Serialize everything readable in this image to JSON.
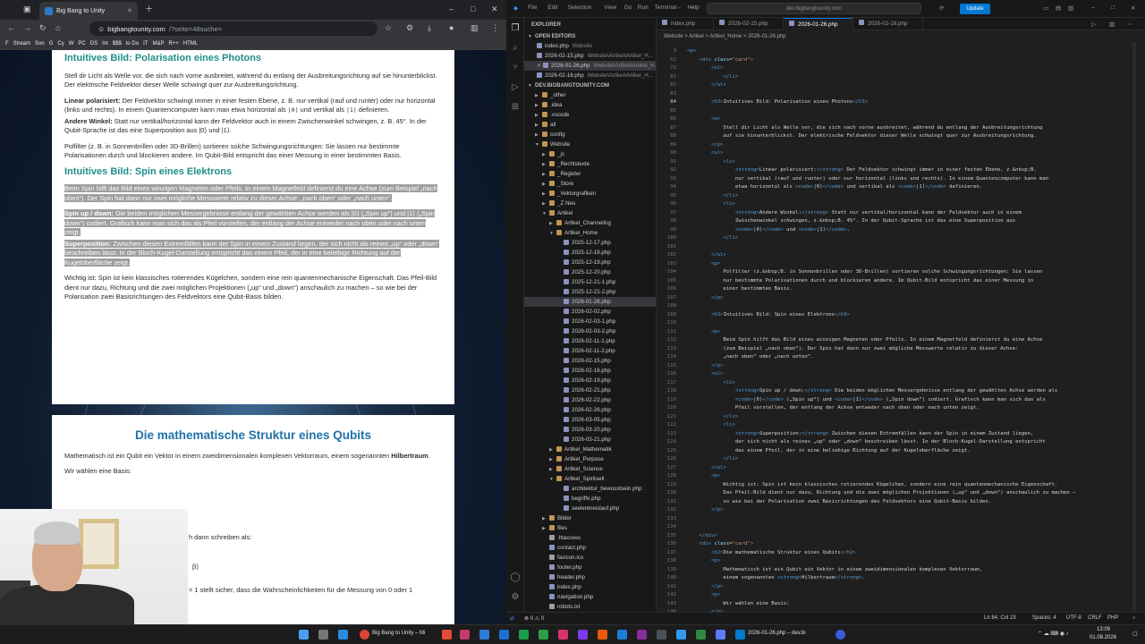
{
  "browser": {
    "tab_title": "Big Bang to Unity",
    "url_domain": "bigbangtounity.com",
    "url_path": "/?seite=48suche=",
    "bookmarks": [
      "F",
      "Stream",
      "Son",
      "G",
      "Cy",
      "W",
      "PC",
      "DS",
      "Int",
      "$$$",
      "to Do",
      "IT",
      "M&P",
      "R++",
      "HTML"
    ],
    "page": {
      "h3_polarisation": "Intuitives Bild: Polarisation eines Photons",
      "p_polar_intro": "Stell dir Licht als Welle vor, die sich nach vorne ausbreitet, während du entlang der Ausbreitungsrichtung auf sie hinunterblickst. Der elektrische Feldvektor dieser Welle schwingt quer zur Ausbreitungsrichtung.",
      "li_linear_strong": "Linear polarisiert:",
      "li_linear_text": "Der Feldvektor schwingt immer in einer festen Ebene, z. B. nur vertikal (rauf und runter) oder nur horizontal (links und rechts). In einem Quantencomputer kann man etwa horizontal als",
      "li_linear_ket0": "|0⟩",
      "li_linear_mid": "und vertikal als",
      "li_linear_ket1": "|1⟩",
      "li_linear_end": "definieren.",
      "li_angle_strong": "Andere Winkel:",
      "li_angle_text": "Statt nur vertikal/horizontal kann der Feldvektor auch in einem Zwischenwinkel schwingen, z. B. 45°. In der Qubit-Sprache ist das eine Superposition aus |0⟩ und |1⟩.",
      "p_polfilter": "Polfilter (z. B. in Sonnenbrillen oder 3D-Brillen) sortieren solche Schwingungsrichtungen: Sie lassen nur bestimmte Polarisationen durch und blockieren andere. Im Qubit-Bild entspricht das einer Messung in einer bestimmten Basis.",
      "h3_spin": "Intuitives Bild: Spin eines Elektrons",
      "p_spin_sel": "Beim Spin hilft das Bild eines winzigen Magneten oder Pfeils. In einem Magnetfeld definierst du eine Achse (zum Beispiel „nach oben“). Der Spin hat dann nur zwei mögliche Messwerte relativ zu dieser Achse: „nach oben“ oder „nach unten“.",
      "li_updown_strong": "Spin up / down:",
      "li_updown_text": "Die beiden möglichen Messergebnisse entlang der gewählten Achse werden als |0⟩ („Spin up“) und |1⟩ („Spin down“) codiert. Grafisch kann man sich das als Pfeil vorstellen, der entlang der Achse entweder nach oben oder nach unten zeigt.",
      "li_super_strong": "Superposition:",
      "li_super_text": "Zwischen diesen Extremfällen kann der Spin in einem Zustand liegen, der sich nicht als reines „up“ oder „down“ beschreiben lässt. In der Bloch-Kugel-Darstellung entspricht das einem Pfeil, der in eine beliebige Richtung auf der Kugeloberfläche zeigt.",
      "p_wichtig": "Wichtig ist: Spin ist kein klassisches rotierendes Kügelchen, sondern eine rein quantenmechanische Eigenschaft. Das Pfeil-Bild dient nur dazu, Richtung und die zwei möglichen Projektionen („up“ und „down“) anschaulich zu machen – so wie bei der Polarisation zwei Basisrichtungen des Feldvektors eine Qubit-Basis bilden.",
      "h2_math": "Die mathematische Struktur eines Qubits",
      "p_math": "Mathematisch ist ein Qubit ein Vektor in einem zweidimensionalen komplexen Vektorraum, einem sogenannten",
      "p_math_strong": "Hilbertraum",
      "p_basis": "Wir wählen eine Basis:",
      "p_partial1": "h dann schreiben als:",
      "p_partial2": "β⟩",
      "p_partial3": "= 1 stellt sicher, dass die Wahrscheinlichkeiten für die Messung von 0 oder 1"
    }
  },
  "vscode": {
    "menu": [
      "File",
      "Edit",
      "Selection",
      "View",
      "Go",
      "Run",
      "Terminal",
      "Help"
    ],
    "command_center": "dev.bigbangtounity.com",
    "update_label": "Update",
    "explorer_title": "EXPLORER",
    "open_editors_title": "OPEN EDITORS",
    "open_editors": [
      {
        "name": "index.php",
        "desc": "Website"
      },
      {
        "name": "2026-02-15.php",
        "desc": "Website\\Artikel\\Artikel_H..."
      },
      {
        "name": "2026-01-26.php",
        "desc": "Website\\Artikel\\Artikel_H..."
      },
      {
        "name": "2026-02-16.php",
        "desc": "Website\\Artikel\\Artikel_H..."
      }
    ],
    "workspace_title": "DEV.BIGBANGTOUNITY.COM",
    "tree": [
      {
        "label": "_other",
        "type": "folder",
        "indent": 1
      },
      {
        "label": ".idea",
        "type": "folder",
        "indent": 1
      },
      {
        "label": ".vscode",
        "type": "folder",
        "indent": 1
      },
      {
        "label": "alt",
        "type": "folder",
        "indent": 1
      },
      {
        "label": "config",
        "type": "folder",
        "indent": 1
      },
      {
        "label": "Website",
        "type": "folder-open",
        "indent": 1
      },
      {
        "label": "_js",
        "type": "folder",
        "indent": 2
      },
      {
        "label": "_Rechtstexte",
        "type": "folder",
        "indent": 2
      },
      {
        "label": "_Register",
        "type": "folder",
        "indent": 2
      },
      {
        "label": "_Store",
        "type": "folder",
        "indent": 2
      },
      {
        "label": "_Vektorgrafiken",
        "type": "folder",
        "indent": 2
      },
      {
        "label": "_Z Neu",
        "type": "folder",
        "indent": 2
      },
      {
        "label": "Artikel",
        "type": "folder-open",
        "indent": 2
      },
      {
        "label": "Artikel_Channeling",
        "type": "folder",
        "indent": 3
      },
      {
        "label": "Artikel_Home",
        "type": "folder-open",
        "indent": 3
      },
      {
        "label": "2025-12-17.php",
        "type": "php",
        "indent": 4
      },
      {
        "label": "2025-12-18.php",
        "type": "php",
        "indent": 4
      },
      {
        "label": "2025-12-19.php",
        "type": "php",
        "indent": 4
      },
      {
        "label": "2025-12-20.php",
        "type": "php",
        "indent": 4
      },
      {
        "label": "2025-12-21-1.php",
        "type": "php",
        "indent": 4
      },
      {
        "label": "2025-12-21-2.php",
        "type": "php",
        "indent": 4
      },
      {
        "label": "2026-01-26.php",
        "type": "php",
        "indent": 4,
        "selected": true
      },
      {
        "label": "2026-02-02.php",
        "type": "php",
        "indent": 4
      },
      {
        "label": "2026-02-03-1.php",
        "type": "php",
        "indent": 4
      },
      {
        "label": "2026-02-03-2.php",
        "type": "php",
        "indent": 4
      },
      {
        "label": "2026-02-11-1.php",
        "type": "php",
        "indent": 4
      },
      {
        "label": "2026-02-11-2.php",
        "type": "php",
        "indent": 4
      },
      {
        "label": "2026-02-15.php",
        "type": "php",
        "indent": 4
      },
      {
        "label": "2026-02-16.php",
        "type": "php",
        "indent": 4
      },
      {
        "label": "2026-02-19.php",
        "type": "php",
        "indent": 4
      },
      {
        "label": "2026-02-21.php",
        "type": "php",
        "indent": 4
      },
      {
        "label": "2026-02-22.php",
        "type": "php",
        "indent": 4
      },
      {
        "label": "2026-02-26.php",
        "type": "php",
        "indent": 4
      },
      {
        "label": "2026-03-05.php",
        "type": "php",
        "indent": 4
      },
      {
        "label": "2026-03-20.php",
        "type": "php",
        "indent": 4
      },
      {
        "label": "2026-03-21.php",
        "type": "php",
        "indent": 4
      },
      {
        "label": "Artikel_Mathematik",
        "type": "folder",
        "indent": 3
      },
      {
        "label": "Artikel_Purpose",
        "type": "folder",
        "indent": 3
      },
      {
        "label": "Artikel_Science",
        "type": "folder",
        "indent": 3
      },
      {
        "label": "Artikel_Spirituell",
        "type": "folder-open",
        "indent": 3
      },
      {
        "label": "architektur_bewusstsein.php",
        "type": "php",
        "indent": 4
      },
      {
        "label": "begriffe.php",
        "type": "php",
        "indent": 4
      },
      {
        "label": "seelenkreislauf.php",
        "type": "php",
        "indent": 4
      },
      {
        "label": "Bilder",
        "type": "folder",
        "indent": 2
      },
      {
        "label": "files",
        "type": "folder",
        "indent": 2
      },
      {
        "label": ".htaccess",
        "type": "file",
        "indent": 2
      },
      {
        "label": "contact.php",
        "type": "php",
        "indent": 2
      },
      {
        "label": "favicon.ico",
        "type": "file",
        "indent": 2
      },
      {
        "label": "footer.php",
        "type": "php",
        "indent": 2
      },
      {
        "label": "header.php",
        "type": "php",
        "indent": 2
      },
      {
        "label": "index.php",
        "type": "php",
        "indent": 2
      },
      {
        "label": "navigation.php",
        "type": "php",
        "indent": 2
      },
      {
        "label": "robots.txt",
        "type": "file",
        "indent": 2
      }
    ],
    "editor_tabs": [
      "index.php",
      "2026-02-15.php",
      "2026-01-26.php",
      "2026-02-16.php"
    ],
    "active_tab_index": 2,
    "breadcrumb": "Website > Artikel > Artikel_Home > 2026-01-26.php",
    "code_lines": [
      {
        "n": "9",
        "t": "<p>"
      },
      {
        "n": "52",
        "t": "    <div class=\"card\">"
      },
      {
        "n": "73",
        "t": "        <ul>"
      },
      {
        "n": "81",
        "t": "            </li>"
      },
      {
        "n": "82",
        "t": "        </ul>"
      },
      {
        "n": "83",
        "t": ""
      },
      {
        "n": "84",
        "t": "        <h3>Intuitives Bild: Polarisation eines Photons</h3>"
      },
      {
        "n": "85",
        "t": ""
      },
      {
        "n": "86",
        "t": "        <p>"
      },
      {
        "n": "87",
        "t": "            Stell dir Licht als Welle vor, die sich nach vorne ausbreitet, während du entlang der Ausbreitungsrichtung"
      },
      {
        "n": "88",
        "t": "            auf sie hinunterblickst. Der elektrische Feldvektor dieser Welle schwingt quer zur Ausbreitungsrichtung."
      },
      {
        "n": "89",
        "t": "        </p>"
      },
      {
        "n": "90",
        "t": "        <ul>"
      },
      {
        "n": "91",
        "t": "            <li>"
      },
      {
        "n": "92",
        "t": "                <strong>Linear polarisiert:</strong> Der Feldvektor schwingt immer in einer festen Ebene, z.&nbsp;B."
      },
      {
        "n": "93",
        "t": "                nur vertikal (rauf und runter) oder nur horizontal (links und rechts). In einem Quantencomputer kann man"
      },
      {
        "n": "94",
        "t": "                etwa horizontal als <code>|0⟩</code> und vertikal als <code>|1⟩</code> definieren."
      },
      {
        "n": "95",
        "t": "            </li>"
      },
      {
        "n": "96",
        "t": "            <li>"
      },
      {
        "n": "97",
        "t": "                <strong>Andere Winkel:</strong> Statt nur vertikal/horizontal kann der Feldvektor auch in einem"
      },
      {
        "n": "98",
        "t": "                Zwischenwinkel schwingen, z.&nbsp;B. 45°. In der Qubit-Sprache ist das eine Superposition aus"
      },
      {
        "n": "99",
        "t": "                <code>|0⟩</code> und <code>|1⟩</code>."
      },
      {
        "n": "100",
        "t": "            </li>"
      },
      {
        "n": "101",
        "t": ""
      },
      {
        "n": "102",
        "t": "        </ul>"
      },
      {
        "n": "103",
        "t": "        <p>"
      },
      {
        "n": "104",
        "t": "            Polfilter (z.&nbsp;B. in Sonnenbrillen oder 3D-Brillen) sortieren solche Schwingungsrichtungen: Sie lassen"
      },
      {
        "n": "105",
        "t": "            nur bestimmte Polarisationen durch und blockieren andere. Im Qubit-Bild entspricht das einer Messung in"
      },
      {
        "n": "106",
        "t": "            einer bestimmten Basis."
      },
      {
        "n": "107",
        "t": "        </p>"
      },
      {
        "n": "108",
        "t": ""
      },
      {
        "n": "109",
        "t": "        <h3>Intuitives Bild: Spin eines Elektrons</h3>"
      },
      {
        "n": "110",
        "t": ""
      },
      {
        "n": "111",
        "t": "        <p>"
      },
      {
        "n": "112",
        "t": "            Beim Spin hilft das Bild eines winzigen Magneten oder Pfeils. In einem Magnetfeld definierst du eine Achse"
      },
      {
        "n": "113",
        "t": "            (zum Beispiel „nach oben“). Der Spin hat dann nur zwei mögliche Messwerte relativ zu dieser Achse:"
      },
      {
        "n": "114",
        "t": "            „nach oben“ oder „nach unten“."
      },
      {
        "n": "115",
        "t": "        </p>"
      },
      {
        "n": "116",
        "t": "        <ul>"
      },
      {
        "n": "117",
        "t": "            <li>"
      },
      {
        "n": "118",
        "t": "                <strong>Spin up / down:</strong> Die beiden möglichen Messergebnisse entlang der gewählten Achse werden als"
      },
      {
        "n": "119",
        "t": "                <code>|0⟩</code> („Spin up“) und <code>|1⟩</code> („Spin down“) codiert. Grafisch kann man sich das als"
      },
      {
        "n": "120",
        "t": "                Pfeil vorstellen, der entlang der Achse entweder nach oben oder nach unten zeigt."
      },
      {
        "n": "121",
        "t": "            </li>"
      },
      {
        "n": "122",
        "t": "            <li>"
      },
      {
        "n": "123",
        "t": "                <strong>Superposition:</strong> Zwischen diesen Extremfällen kann der Spin in einem Zustand liegen,"
      },
      {
        "n": "124",
        "t": "                der sich nicht als reines „up“ oder „down“ beschreiben lässt. In der Bloch-Kugel-Darstellung entspricht"
      },
      {
        "n": "125",
        "t": "                das einem Pfeil, der in eine beliebige Richtung auf der Kugeloberfläche zeigt."
      },
      {
        "n": "126",
        "t": "            </li>"
      },
      {
        "n": "127",
        "t": "        </ul>"
      },
      {
        "n": "128",
        "t": "        <p>"
      },
      {
        "n": "129",
        "t": "            Wichtig ist: Spin ist kein klassisches rotierendes Kügelchen, sondern eine rein quantenmechanische Eigenschaft."
      },
      {
        "n": "130",
        "t": "            Das Pfeil-Bild dient nur dazu, Richtung und die zwei möglichen Projektionen („up“ und „down“) anschaulich zu machen –"
      },
      {
        "n": "131",
        "t": "            so wie bei der Polarisation zwei Basisrichtungen des Feldvektors eine Qubit-Basis bilden."
      },
      {
        "n": "132",
        "t": "        </p>"
      },
      {
        "n": "133",
        "t": ""
      },
      {
        "n": "134",
        "t": ""
      },
      {
        "n": "135",
        "t": "    </div>"
      },
      {
        "n": "136",
        "t": "    <div class=\"card\">"
      },
      {
        "n": "137",
        "t": "        <h2>Die mathematische Struktur eines Qubits</h2>"
      },
      {
        "n": "138",
        "t": "        <p>"
      },
      {
        "n": "139",
        "t": "            Mathematisch ist ein Qubit ein Vektor in einem zweidimensionalen komplexen Vektorraum,"
      },
      {
        "n": "140",
        "t": "            einem sogenannten <strong>Hilbertraum</strong>."
      },
      {
        "n": "141",
        "t": "        </p>"
      },
      {
        "n": "142",
        "t": "        <p>"
      },
      {
        "n": "143",
        "t": "            Wir wählen eine Basis:"
      },
      {
        "n": "144",
        "t": "        </p>"
      }
    ],
    "status": {
      "errors": "0",
      "warnings": "0",
      "position": "Ln 84, Col 23",
      "spaces": "Spaces: 4",
      "encoding": "UTF-8",
      "eol": "CRLF",
      "language": "PHP"
    }
  },
  "taskbar": {
    "browser_label": "Big Bang to Unity – Mi",
    "vscode_label": "2026-01-26.php – dev.bi",
    "time": "13:09",
    "date": "01.08.2026"
  }
}
